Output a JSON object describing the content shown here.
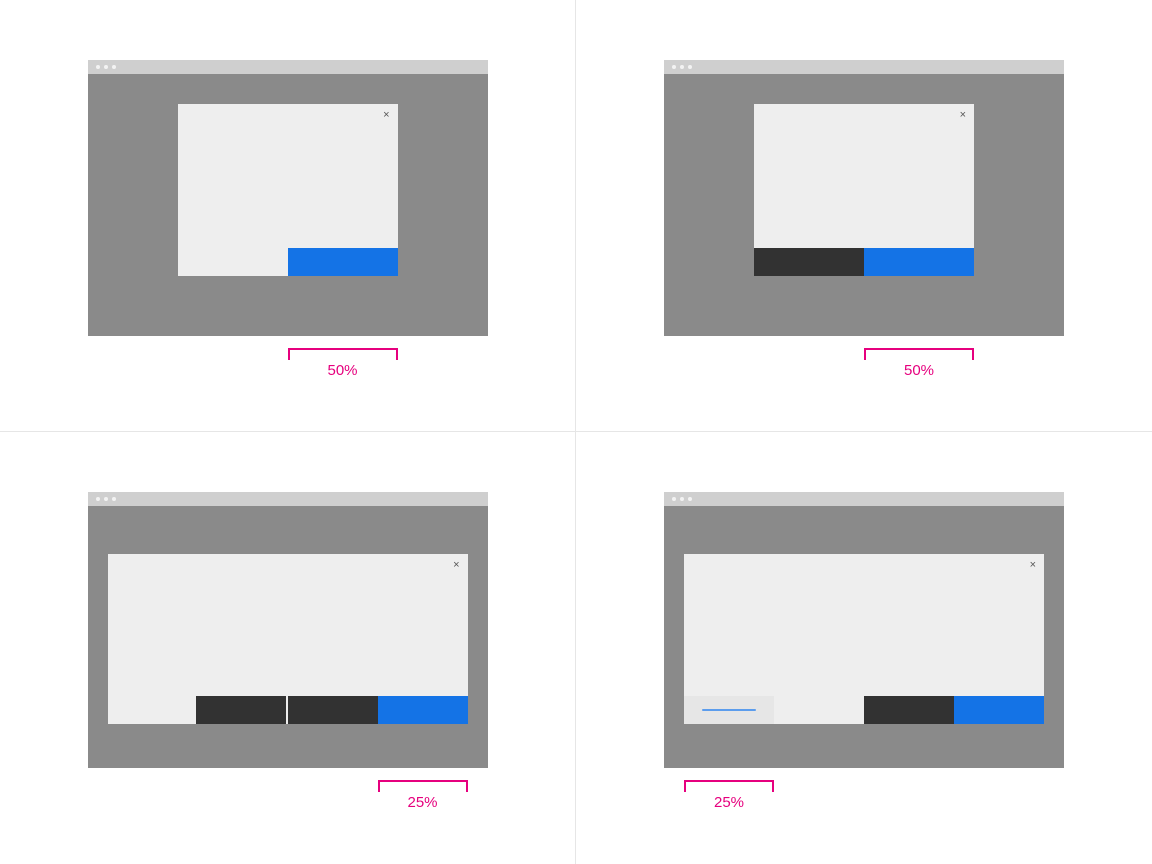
{
  "annotations": {
    "c1": {
      "width_label": "50%"
    },
    "c2": {
      "width_label": "50%"
    },
    "c3": {
      "width_label": "25%"
    },
    "c4": {
      "width_label": "25%"
    }
  },
  "close_glyph": "×",
  "colors": {
    "primary": "#1473e6",
    "secondary": "#323232",
    "tertiary_bg": "#e6e6e6",
    "annotation": "#e6007e",
    "viewport": "#8a8a8a",
    "modal": "#eeeeee"
  },
  "diagrams": {
    "c1": {
      "modal_width_pct": 50,
      "buttons": [
        "primary"
      ]
    },
    "c2": {
      "modal_width_pct": 50,
      "buttons": [
        "secondary",
        "primary"
      ]
    },
    "c3": {
      "modal_width_pct": 25,
      "buttons": [
        "secondary",
        "secondary",
        "primary"
      ]
    },
    "c4": {
      "modal_width_pct": 25,
      "buttons_right": [
        "secondary",
        "primary"
      ],
      "button_left": "tertiary"
    }
  }
}
